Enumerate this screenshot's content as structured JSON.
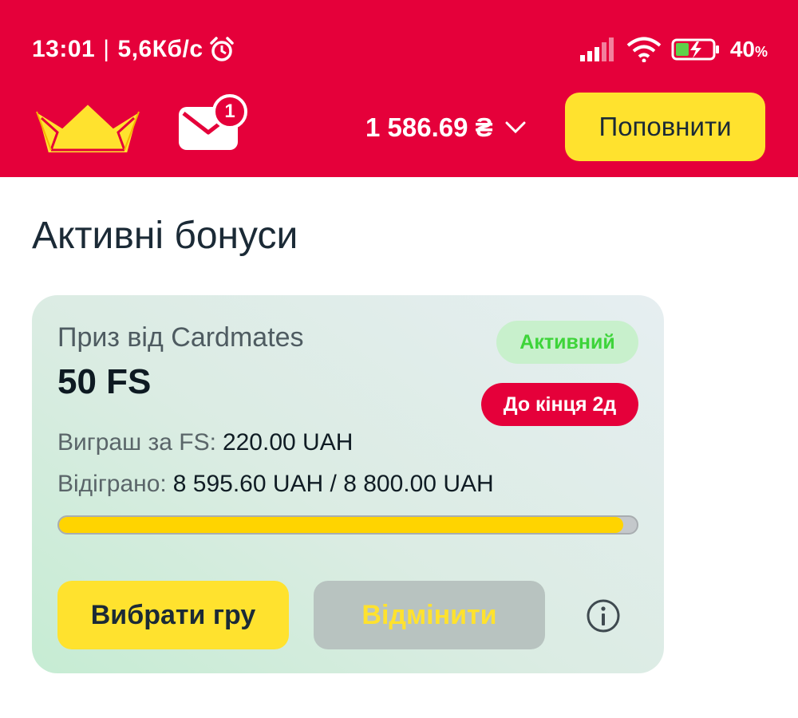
{
  "status_bar": {
    "time": "13:01",
    "separator": "|",
    "speed": "5,6Кб/с",
    "battery": "40",
    "battery_unit": "%",
    "icons": [
      "alarm-icon",
      "signal-icon",
      "wifi-icon",
      "battery-charging-icon"
    ]
  },
  "header": {
    "logo": "crown-logo",
    "mail_badge_count": "1",
    "balance": "1 586.69 ₴",
    "topup_label": "Поповнити",
    "brand_color": "#e5003a",
    "accent_color": "#ffe22e"
  },
  "page": {
    "title": "Активні бонуси"
  },
  "bonus": {
    "prize_label": "Приз від Cardmates",
    "amount": "50 FS",
    "status": "Активний",
    "deadline": "До кінця 2д",
    "win_label": "Виграш за FS:",
    "win_value": "220.00 UAH",
    "wager_label": "Відіграно:",
    "wager_value": "8 595.60 UAH / 8 800.00 UAH",
    "progress_fraction": 0.9768,
    "choose_game_label": "Вибрати гру",
    "cancel_label": "Відмінити"
  }
}
